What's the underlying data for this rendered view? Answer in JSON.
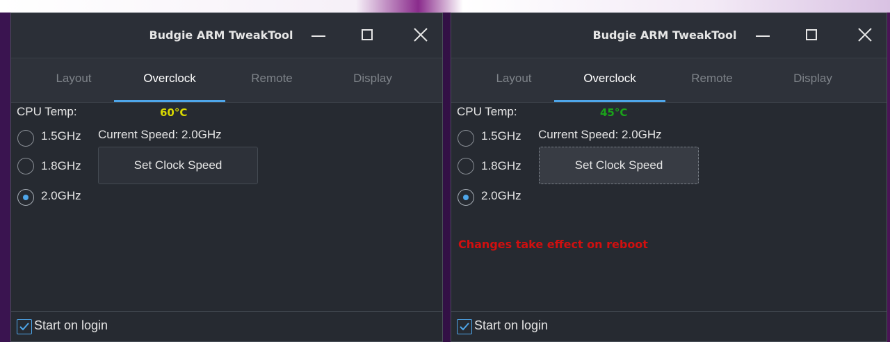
{
  "windows": [
    {
      "title": "Budgie ARM TweakTool",
      "tabs": [
        "Layout",
        "Overclock",
        "Remote",
        "Display"
      ],
      "active_tab": "Overclock",
      "cpu_temp_label": "CPU Temp:",
      "cpu_temp_value": "60°C",
      "cpu_temp_color": "#d8d800",
      "radios": [
        "1.5GHz",
        "1.8GHz",
        "2.0GHz"
      ],
      "selected": "2.0GHz",
      "current_speed": "Current Speed: 2.0GHz",
      "set_button": "Set Clock Speed",
      "notice": "",
      "start_on_login": "Start on login",
      "start_on_login_checked": true
    },
    {
      "title": "Budgie ARM TweakTool",
      "tabs": [
        "Layout",
        "Overclock",
        "Remote",
        "Display"
      ],
      "active_tab": "Overclock",
      "cpu_temp_label": "CPU Temp:",
      "cpu_temp_value": "45°C",
      "cpu_temp_color": "#1aa31a",
      "radios": [
        "1.5GHz",
        "1.8GHz",
        "2.0GHz"
      ],
      "selected": "2.0GHz",
      "current_speed": "Current Speed: 2.0GHz",
      "set_button": "Set Clock Speed",
      "notice": "Changes take effect on reboot",
      "notice_color": "#d10f0f",
      "start_on_login": "Start on login",
      "start_on_login_checked": true
    }
  ]
}
